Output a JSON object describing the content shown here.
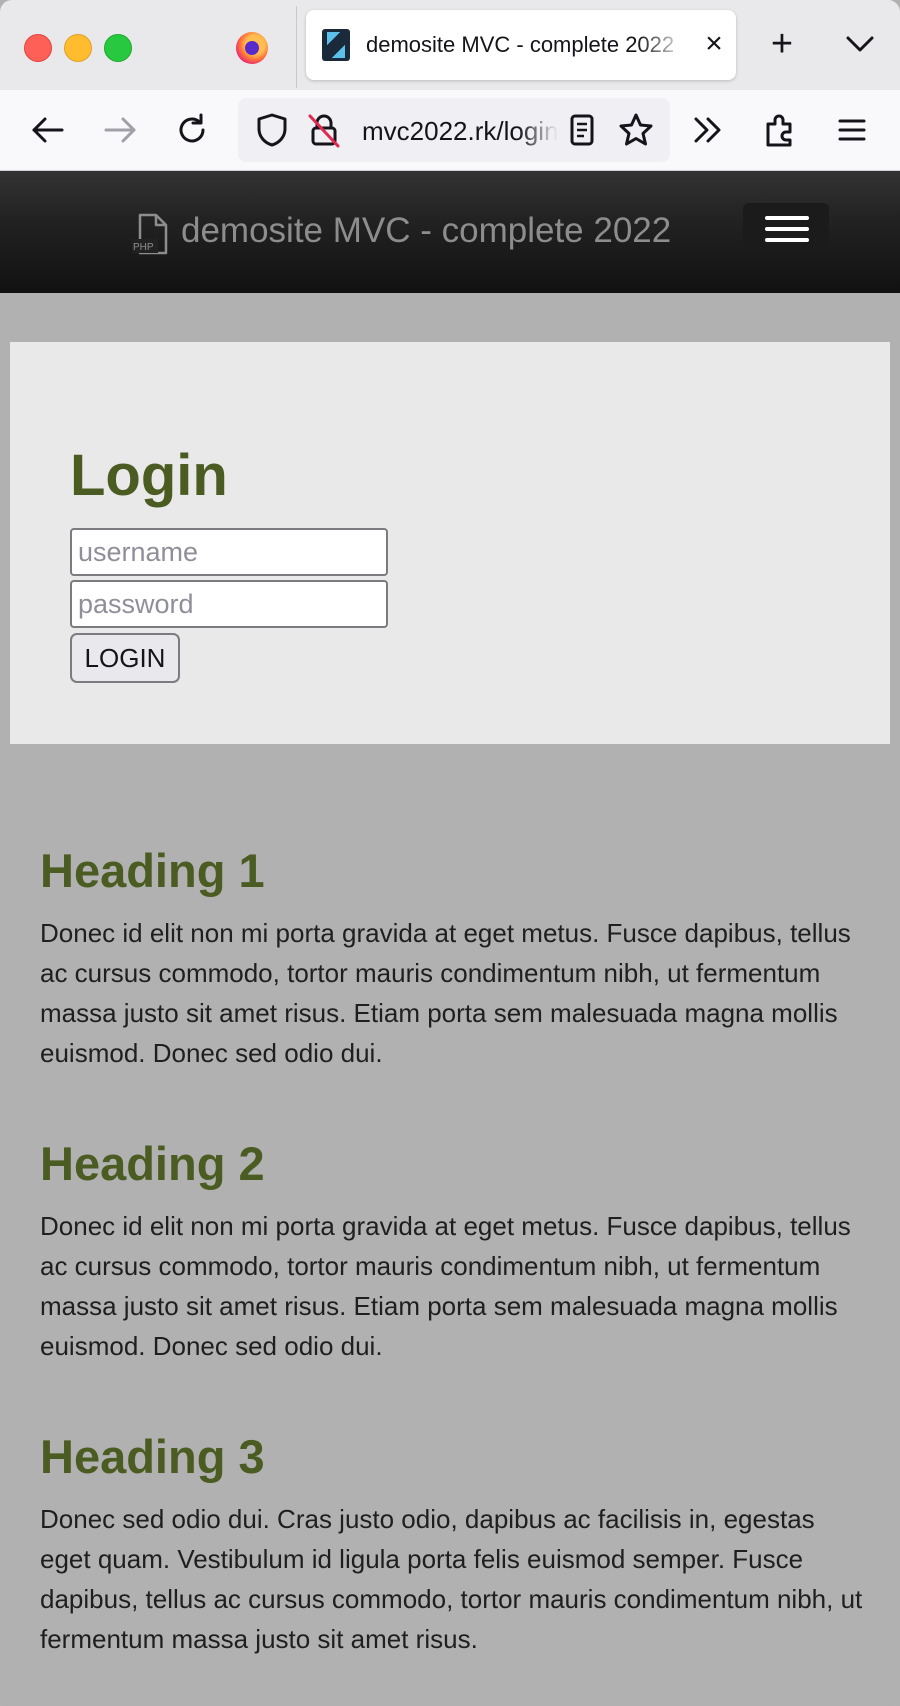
{
  "browser": {
    "tab_title": "demosite MVC - complete 2022",
    "url": "mvc2022.rk/login"
  },
  "site": {
    "brand_title": "demosite MVC - complete 2022",
    "brand_icon_label": "PHP"
  },
  "login": {
    "heading": "Login",
    "username_placeholder": "username",
    "password_placeholder": "password",
    "button_label": "LOGIN"
  },
  "sections": [
    {
      "heading": "Heading 1",
      "text": "Donec id elit non mi porta gravida at eget metus. Fusce dapibus, tellus ac cursus commodo, tortor mauris condimentum nibh, ut fermentum massa justo sit amet risus. Etiam porta sem malesuada magna mollis euismod. Donec sed odio dui."
    },
    {
      "heading": "Heading 2",
      "text": "Donec id elit non mi porta gravida at eget metus. Fusce dapibus, tellus ac cursus commodo, tortor mauris condimentum nibh, ut fermentum massa justo sit amet risus. Etiam porta sem malesuada magna mollis euismod. Donec sed odio dui."
    },
    {
      "heading": "Heading 3",
      "text": "Donec sed odio dui. Cras justo odio, dapibus ac facilisis in, egestas eget quam. Vestibulum id ligula porta felis euismod semper. Fusce dapibus, tellus ac cursus commodo, tortor mauris condimentum nibh, ut fermentum massa justo sit amet risus."
    }
  ],
  "colors": {
    "heading_green": "#4b5c22",
    "page_background": "#b1b1b1",
    "hero_background": "#e9e9ea",
    "header_dark": "#111111"
  },
  "icons": [
    "firefox-icon",
    "site-favicon",
    "close-icon",
    "plus-icon",
    "chevron-down-icon",
    "back-arrow-icon",
    "forward-arrow-icon",
    "reload-icon",
    "shield-icon",
    "insecure-lock-icon",
    "reader-view-icon",
    "star-icon",
    "overflow-chevrons-icon",
    "extensions-icon",
    "hamburger-menu-icon",
    "php-file-icon"
  ]
}
